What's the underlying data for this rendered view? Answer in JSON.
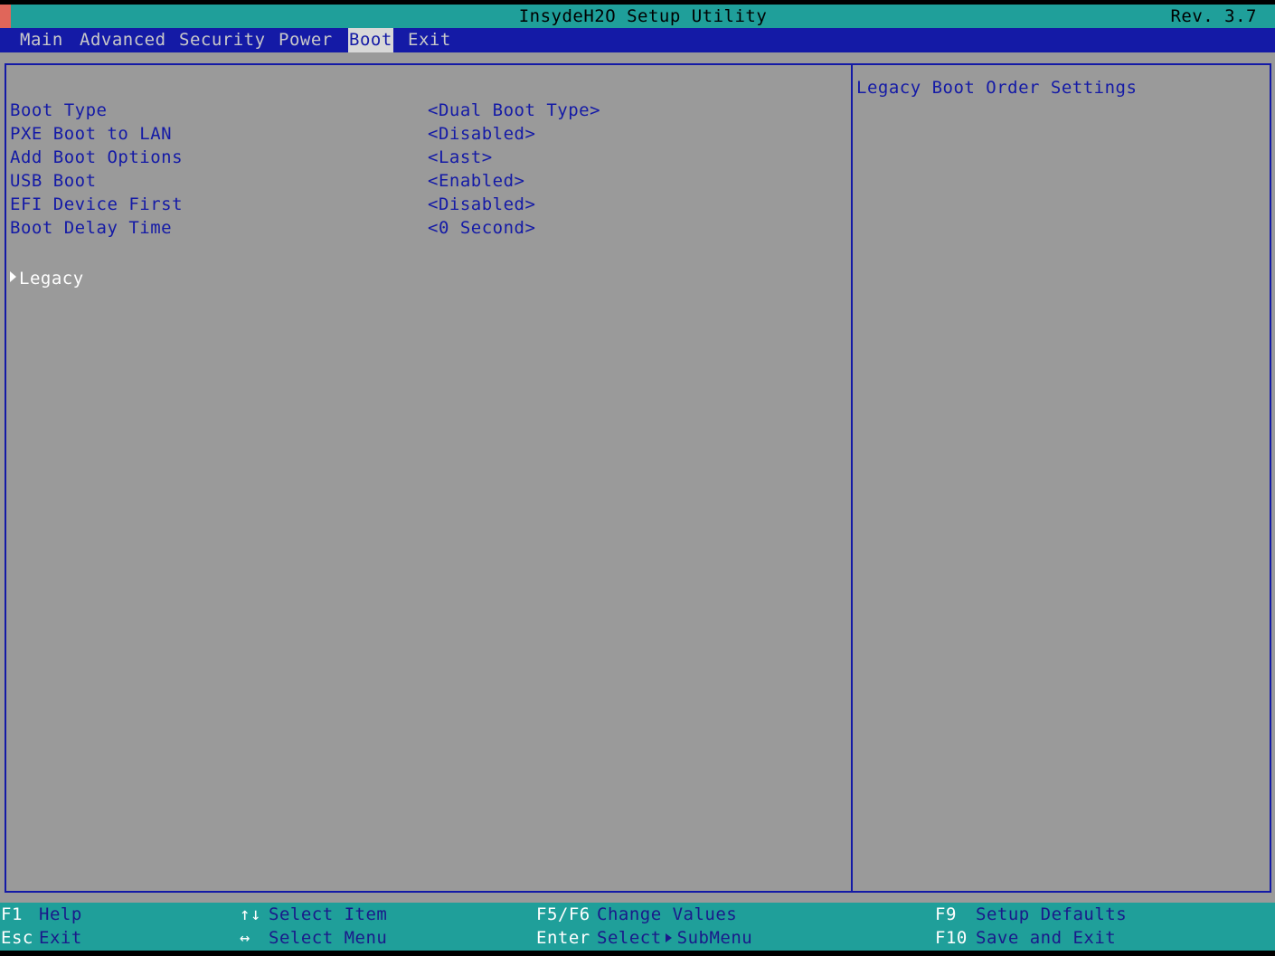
{
  "title_bar": {
    "title": "InsydeH2O Setup Utility",
    "revision": "Rev. 3.7"
  },
  "menu": {
    "tabs": [
      {
        "label": "Main"
      },
      {
        "label": "Advanced"
      },
      {
        "label": "Security"
      },
      {
        "label": "Power"
      },
      {
        "label": "Boot"
      },
      {
        "label": "Exit"
      }
    ],
    "active_tab": "Boot"
  },
  "boot_settings": [
    {
      "label": "Boot Type",
      "value": "<Dual Boot Type>"
    },
    {
      "label": "PXE Boot to LAN",
      "value": "<Disabled>"
    },
    {
      "label": "Add Boot Options",
      "value": "<Last>"
    },
    {
      "label": "USB Boot",
      "value": "<Enabled>"
    },
    {
      "label": "EFI Device First",
      "value": "<Disabled>"
    },
    {
      "label": "Boot Delay Time",
      "value": "<0 Second>"
    }
  ],
  "submenu": {
    "label": "Legacy",
    "icon": "triangle-right-icon"
  },
  "help_panel": {
    "text": "Legacy Boot Order Settings"
  },
  "footer": {
    "f1_key": "F1",
    "f1_desc": "Help",
    "esc_key": "Esc",
    "esc_desc": "Exit",
    "updown_icon": "↑↓",
    "updown_desc": "Select Item",
    "leftright_icon": "↔",
    "leftright_desc": "Select Menu",
    "f5f6_key": "F5/F6",
    "f5f6_desc": "Change Values",
    "enter_key": "Enter",
    "enter_desc_1": "Select",
    "enter_desc_2": "SubMenu",
    "f9_key": "F9",
    "f9_desc": "Setup Defaults",
    "f10_key": "F10",
    "f10_desc": "Save and Exit"
  },
  "colors": {
    "title_bar": "#1f9f9a",
    "menu_bar": "#141aa6",
    "content_bg": "#9a9a9a",
    "text_blue": "#141aa6",
    "highlight": "#ffffff",
    "corner_mark": "#e0665a"
  }
}
